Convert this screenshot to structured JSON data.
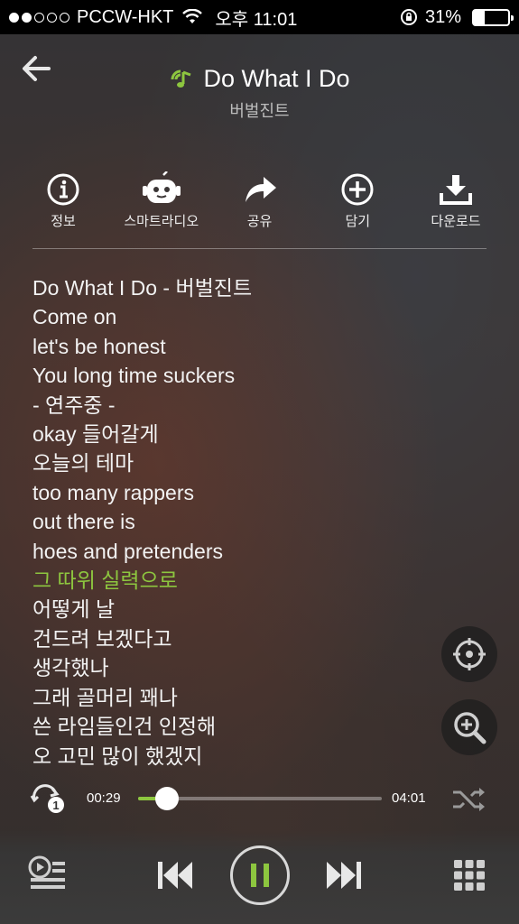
{
  "status_bar": {
    "carrier": "PCCW-HKT",
    "time": "오후 11:01",
    "battery": "31%",
    "battery_level": 0.31
  },
  "header": {
    "title": "Do What I Do",
    "artist": "버벌진트"
  },
  "actions": [
    {
      "icon": "info-icon",
      "label": "정보"
    },
    {
      "icon": "robot-radio-icon",
      "label": "스마트라디오"
    },
    {
      "icon": "share-icon",
      "label": "공유"
    },
    {
      "icon": "add-circle-icon",
      "label": "담기"
    },
    {
      "icon": "download-icon",
      "label": "다운로드"
    }
  ],
  "lyrics": [
    "Do What I Do - 버벌진트",
    "Come on",
    "let's be honest",
    "You long time suckers",
    " - 연주중 -",
    "okay 들어갈게",
    "오늘의 테마",
    "too many rappers",
    "out there is",
    "hoes and pretenders",
    "그 따위 실력으로",
    "어떻게 날",
    "건드려 보겠다고",
    "생각했나",
    "그래 골머리 꽤나",
    "쓴 라임들인건 인정해",
    "오 고민 많이 했겠지"
  ],
  "current_lyric_index": 10,
  "player": {
    "elapsed": "00:29",
    "total": "04:01",
    "progress": 0.12
  },
  "colors": {
    "accent": "#8dc63f"
  }
}
